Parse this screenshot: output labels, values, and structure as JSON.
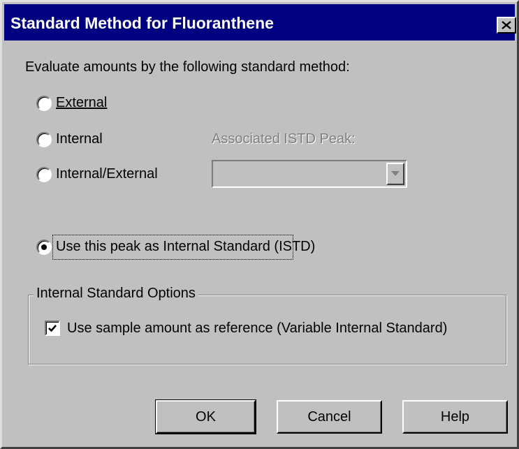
{
  "window": {
    "title": "Standard Method for Fluoranthene",
    "close_symbol": "close-icon"
  },
  "prompt": "Evaluate amounts by the following standard method:",
  "methods": [
    {
      "label": "External",
      "accel": "E",
      "checked": false
    },
    {
      "label": "Internal",
      "accel": "I",
      "checked": false
    },
    {
      "label": "Internal/External",
      "accel": "n",
      "checked": false
    }
  ],
  "istd_peak": {
    "label": "Associated ISTD Peak:",
    "value": ""
  },
  "use_as_istd": {
    "label": "Use this peak as Internal Standard (ISTD)",
    "checked": true
  },
  "options_group": {
    "title": "Internal Standard Options",
    "variable_istd": {
      "label": "Use sample amount as reference (Variable Internal Standard)",
      "checked": true
    }
  },
  "buttons": {
    "ok": "OK",
    "cancel": "Cancel",
    "help": "Help"
  },
  "colors": {
    "titlebar": "#000080",
    "face": "#c0c0c0"
  }
}
